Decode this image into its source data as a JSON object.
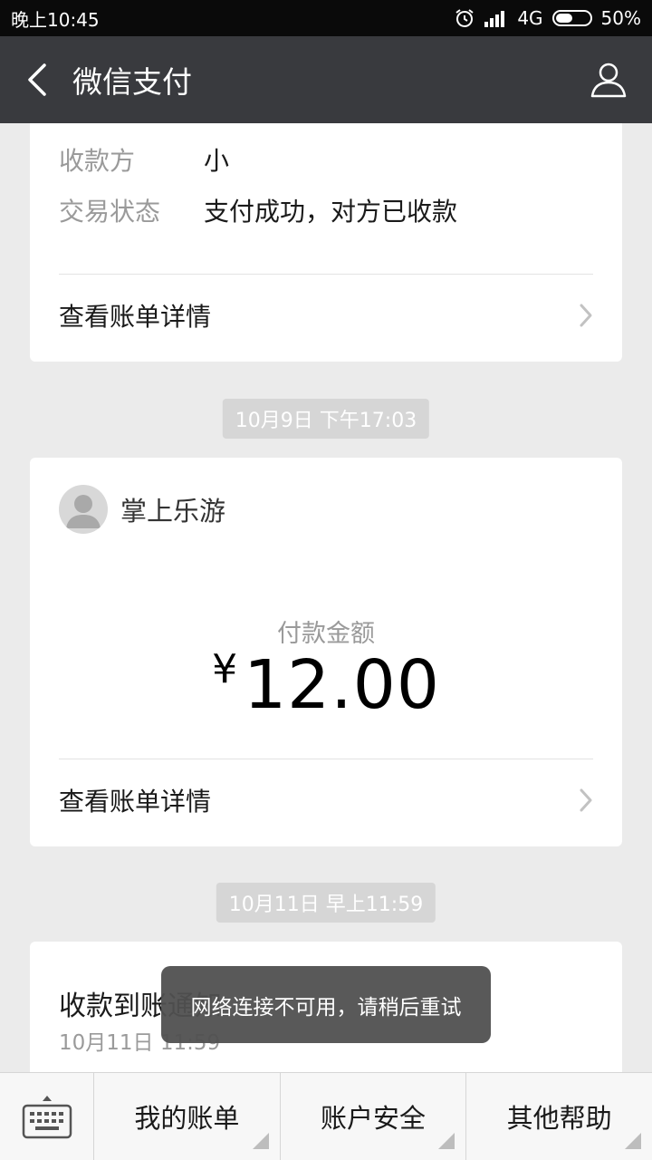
{
  "status": {
    "time": "晚上10:45",
    "network": "4G",
    "battery": "50%"
  },
  "appbar": {
    "title": "微信支付"
  },
  "card1": {
    "payee_label": "收款方",
    "payee_value": "小",
    "status_label": "交易状态",
    "status_value": "支付成功，对方已收款",
    "link": "查看账单详情"
  },
  "time1": "10月9日 下午17:03",
  "card2": {
    "merchant": "掌上乐游",
    "amount_label": "付款金额",
    "currency": "¥",
    "amount": "12.00",
    "link": "查看账单详情"
  },
  "time2": "10月11日 早上11:59",
  "card3": {
    "title": "收款到账通知",
    "time": "10月11日  11:59"
  },
  "toast": "网络连接不可用，请稍后重试",
  "bottom": {
    "items": [
      "我的账单",
      "账户安全",
      "其他帮助"
    ]
  },
  "colors": {
    "appbar": "#393a3e",
    "background": "#ebebeb",
    "toast": "#505050"
  }
}
